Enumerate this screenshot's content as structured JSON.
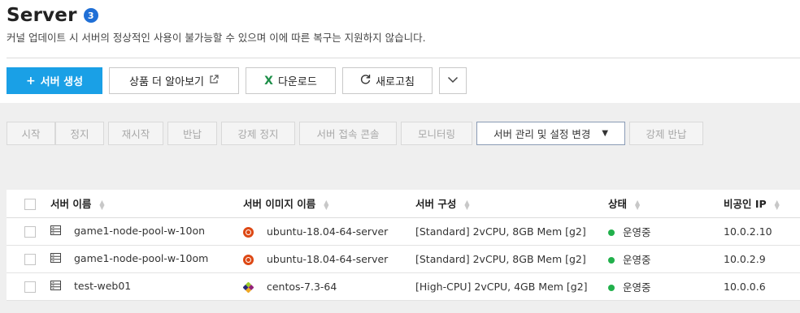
{
  "header": {
    "title": "Server",
    "count": "3",
    "notice": "커널 업데이트 시 서버의 정상적인 사용이 불가능할 수 있으며 이에 따른 복구는 지원하지 않습니다."
  },
  "toolbar": {
    "create_label": "서버 생성",
    "learn_more_label": "상품 더 알아보기",
    "download_label": "다운로드",
    "refresh_label": "새로고침"
  },
  "actions": {
    "start": "시작",
    "stop": "정지",
    "restart": "재시작",
    "return": "반납",
    "force_stop": "강제 정지",
    "console": "서버 접속 콘솔",
    "monitoring": "모니터링",
    "manage": "서버 관리 및 설정 변경",
    "force_return": "강제 반납"
  },
  "table": {
    "columns": [
      "서버 이름",
      "서버 이미지 이름",
      "서버 구성",
      "상태",
      "비공인 IP"
    ],
    "rows": [
      {
        "name": "game1-node-pool-w-10on",
        "image": "ubuntu-18.04-64-server",
        "image_icon": "ubuntu-icon",
        "spec": "[Standard] 2vCPU, 8GB Mem [g2]",
        "status": "운영중",
        "ip": "10.0.2.10"
      },
      {
        "name": "game1-node-pool-w-10om",
        "image": "ubuntu-18.04-64-server",
        "image_icon": "ubuntu-icon",
        "spec": "[Standard] 2vCPU, 8GB Mem [g2]",
        "status": "운영중",
        "ip": "10.0.2.9"
      },
      {
        "name": "test-web01",
        "image": "centos-7.3-64",
        "image_icon": "centos-icon",
        "spec": "[High-CPU] 2vCPU, 4GB Mem [g2]",
        "status": "운영중",
        "ip": "10.0.0.6"
      }
    ]
  },
  "colors": {
    "primary": "#1aa0e6",
    "badge": "#1f6fd6",
    "status_running": "#21b04b",
    "excel": "#1e8f49",
    "ubuntu": "#dd4814"
  }
}
